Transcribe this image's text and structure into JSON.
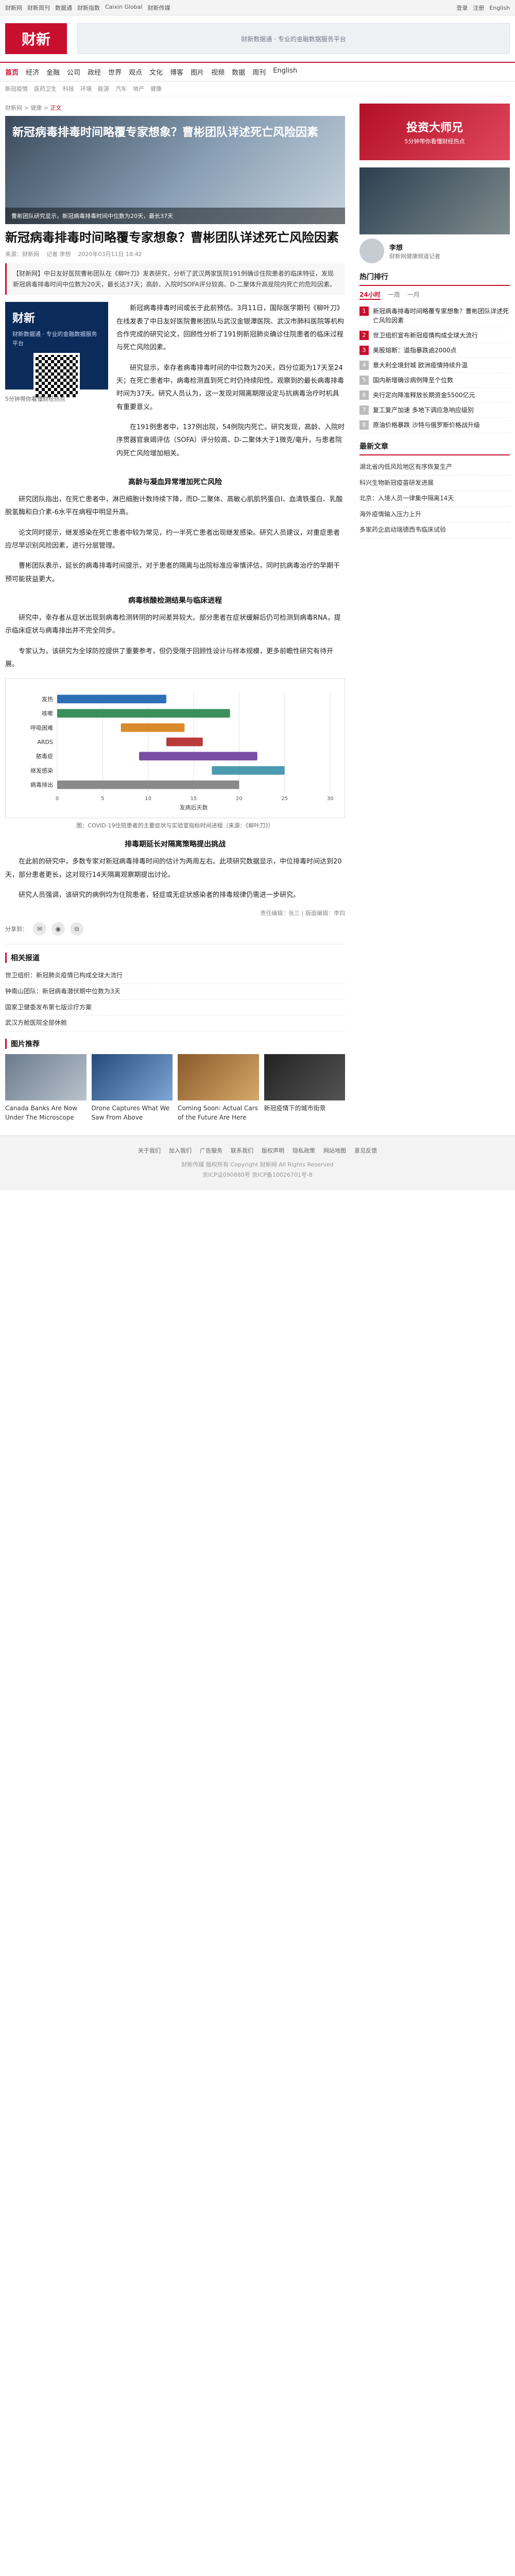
{
  "topbar": {
    "links": [
      "财新网",
      "财新周刊",
      "数据通",
      "财新指数",
      "Caixin Global",
      "财新传媒"
    ],
    "right": [
      "登录",
      "注册",
      "English"
    ]
  },
  "header": {
    "logo": "财新",
    "ad": "财新数据通 · 专业的金融数据服务平台"
  },
  "nav": [
    "首页",
    "经济",
    "金融",
    "公司",
    "政经",
    "世界",
    "观点",
    "文化",
    "博客",
    "图片",
    "视频",
    "数据",
    "周刊",
    "English"
  ],
  "subnav": [
    "新冠疫情",
    "医药卫生",
    "科技",
    "环境",
    "能源",
    "汽车",
    "地产",
    "健康"
  ],
  "crumb": {
    "prefix": "财新网 > 健康 >",
    "current": "正文"
  },
  "hero": {
    "title": "新冠病毒排毒时间略覆专家想象？曹彬团队详述死亡风险因素",
    "caption": "曹彬团队研究显示，新冠病毒排毒时间中位数为20天，最长37天"
  },
  "article": {
    "title": "新冠病毒排毒时间略覆专家想象？曹彬团队详述死亡风险因素",
    "source": "来源：财新网",
    "author": "记者 李想",
    "date": "2020年03月11日 18:42",
    "lead": "【财新网】中日友好医院曹彬团队在《柳叶刀》发表研究，分析了武汉两家医院191例确诊住院患者的临床特征，发现新冠病毒排毒时间中位数为20天，最长达37天；高龄、入院时SOFA评分较高、D-二聚体升高是院内死亡的危险因素。",
    "paragraphs": [
      "新冠病毒排毒时间或长于此前预估。3月11日，国际医学期刊《柳叶刀》在线发表了中日友好医院曹彬团队与武汉金银潭医院、武汉市肺科医院等机构合作完成的研究论文，回顾性分析了191例新冠肺炎确诊住院患者的临床过程与死亡风险因素。",
      "研究显示，幸存者病毒排毒时间的中位数为20天，四分位距为17天至24天；在死亡患者中，病毒检测直到死亡时仍持续阳性。观察到的最长病毒排毒时间为37天。研究人员认为，这一发现对隔离期限设定与抗病毒治疗时机具有重要意义。",
      "在191例患者中，137例出院，54例院内死亡。研究发现，高龄、入院时序贯器官衰竭评估（SOFA）评分较高、D-二聚体大于1微克/毫升，与患者院内死亡风险增加相关。"
    ],
    "subhead1": "高龄与凝血异常增加死亡风险",
    "paragraphs2": [
      "研究团队指出，在死亡患者中，淋巴细胞计数持续下降，而D-二聚体、高敏心肌肌钙蛋白I、血清铁蛋白、乳酸脱氢酶和白介素-6水平在病程中明显升高。",
      "论文同时提示，继发感染在死亡患者中较为常见，约一半死亡患者出现继发感染。研究人员建议，对重症患者应尽早识别风险因素，进行分层管理。",
      "曹彬团队表示，延长的病毒排毒时间提示，对于患者的隔离与出院标准应审慎评估，同时抗病毒治疗的早期干预可能获益更大。"
    ],
    "subhead2": "病毒核酸检测结果与临床进程",
    "paragraphs3": [
      "研究中，幸存者从症状出现到病毒检测转阴的时间差异较大。部分患者在症状缓解后仍可检测到病毒RNA，提示临床症状与病毒排出并不完全同步。",
      "专家认为，该研究为全球防控提供了重要参考，但仍受限于回顾性设计与样本规模，更多前瞻性研究有待开展。"
    ],
    "figure_caption": "图：COVID-19住院患者的主要症状与实验室指标时间进程（来源：《柳叶刀》）",
    "subhead3": "排毒期延长对隔离策略提出挑战",
    "paragraphs4": [
      "在此前的研究中，多数专家对新冠病毒排毒时间的估计为两周左右。此项研究数据显示，中位排毒时间达到20天，部分患者更长，这对现行14天隔离观察期提出讨论。",
      "研究人员强调，该研究的病例均为住院患者，轻症或无症状感染者的排毒规律仍需进一步研究。"
    ],
    "editor": "责任编辑：张三 | 版面编辑：李四",
    "share_label": "分享到："
  },
  "related": {
    "title": "相关报道",
    "items": [
      "世卫组织：新冠肺炎疫情已构成全球大流行",
      "钟南山团队：新冠病毒潜伏期中位数为3天",
      "国家卫健委发布第七版诊疗方案",
      "武汉方舱医院全部休舱"
    ]
  },
  "cards": {
    "title": "图片推荐",
    "items": [
      "Canada Banks Are Now Under The Microscope",
      "Drone Captures What We Saw From Above",
      "Coming Soon: Actual Cars of the Future Are Here",
      "新冠疫情下的城市街景"
    ]
  },
  "side": {
    "ad": {
      "big": "投资大师兄",
      "small": "5分钟带你看懂财经热点"
    },
    "author": {
      "name": "李想",
      "desc": "财新网健康频道记者"
    },
    "rank_title": "热门排行",
    "rank_tabs": [
      "24小时",
      "一周",
      "一月"
    ],
    "rank": [
      "新冠病毒排毒时间略覆专家想象？曹彬团队详述死亡风险因素",
      "世卫组织宣布新冠疫情构成全球大流行",
      "美股熔断：道指暴跌逾2000点",
      "意大利全境封城 欧洲疫情持续升温",
      "国内新增确诊病例降至个位数",
      "央行定向降准释放长期资金5500亿元",
      "复工复产加速 多地下调应急响应级别",
      "原油价格暴跌 沙特与俄罗斯价格战升级"
    ],
    "latest_title": "最新文章",
    "latest": [
      "湖北省内低风险地区有序恢复生产",
      "科兴生物新冠疫苗研发进展",
      "北京：入境人员一律集中隔离14天",
      "海外疫情输入压力上升",
      "多家药企启动瑞德西韦临床试验"
    ]
  },
  "footer": {
    "links": [
      "关于我们",
      "加入我们",
      "广告服务",
      "联系我们",
      "版权声明",
      "隐私政策",
      "网站地图",
      "意见反馈"
    ],
    "copy1": "财新传媒 版权所有 Copyright 财新网 All Rights Reserved",
    "copy2": "京ICP证090880号 京ICP备10026701号-8"
  },
  "chart_data": {
    "type": "timeline",
    "title": "",
    "rows": [
      "发热",
      "咳嗽",
      "呼吸困难",
      "ARDS",
      "脓毒症",
      "继发感染",
      "病毒排出"
    ],
    "x": [
      0,
      5,
      10,
      15,
      20,
      25,
      30
    ],
    "xlabel": "发病后天数"
  }
}
